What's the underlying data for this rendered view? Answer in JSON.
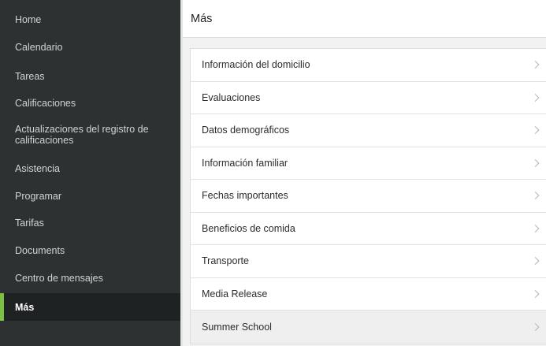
{
  "sidebar": {
    "items": [
      {
        "label": "Home"
      },
      {
        "label": "Calendario"
      },
      {
        "label": "Tareas"
      },
      {
        "label": "Calificaciones"
      },
      {
        "label": "Actualizaciones del registro de calificaciones"
      },
      {
        "label": "Asistencia"
      },
      {
        "label": "Programar"
      },
      {
        "label": "Tarifas"
      },
      {
        "label": "Documents"
      },
      {
        "label": "Centro de mensajes"
      },
      {
        "label": "Más",
        "active": true
      }
    ]
  },
  "header": {
    "title": "Más"
  },
  "main": {
    "items": [
      {
        "label": "Información del domicilio"
      },
      {
        "label": "Evaluaciones"
      },
      {
        "label": "Datos demográficos"
      },
      {
        "label": "Información familiar"
      },
      {
        "label": "Fechas importantes"
      },
      {
        "label": "Beneficios de comida"
      },
      {
        "label": "Transporte"
      },
      {
        "label": "Media Release"
      },
      {
        "label": "Summer School"
      }
    ]
  },
  "colors": {
    "sidebar_bg": "#2e3132",
    "active_bg": "#1f2223",
    "accent": "#7bc043"
  },
  "icons": [
    "chevron-right-icon"
  ]
}
